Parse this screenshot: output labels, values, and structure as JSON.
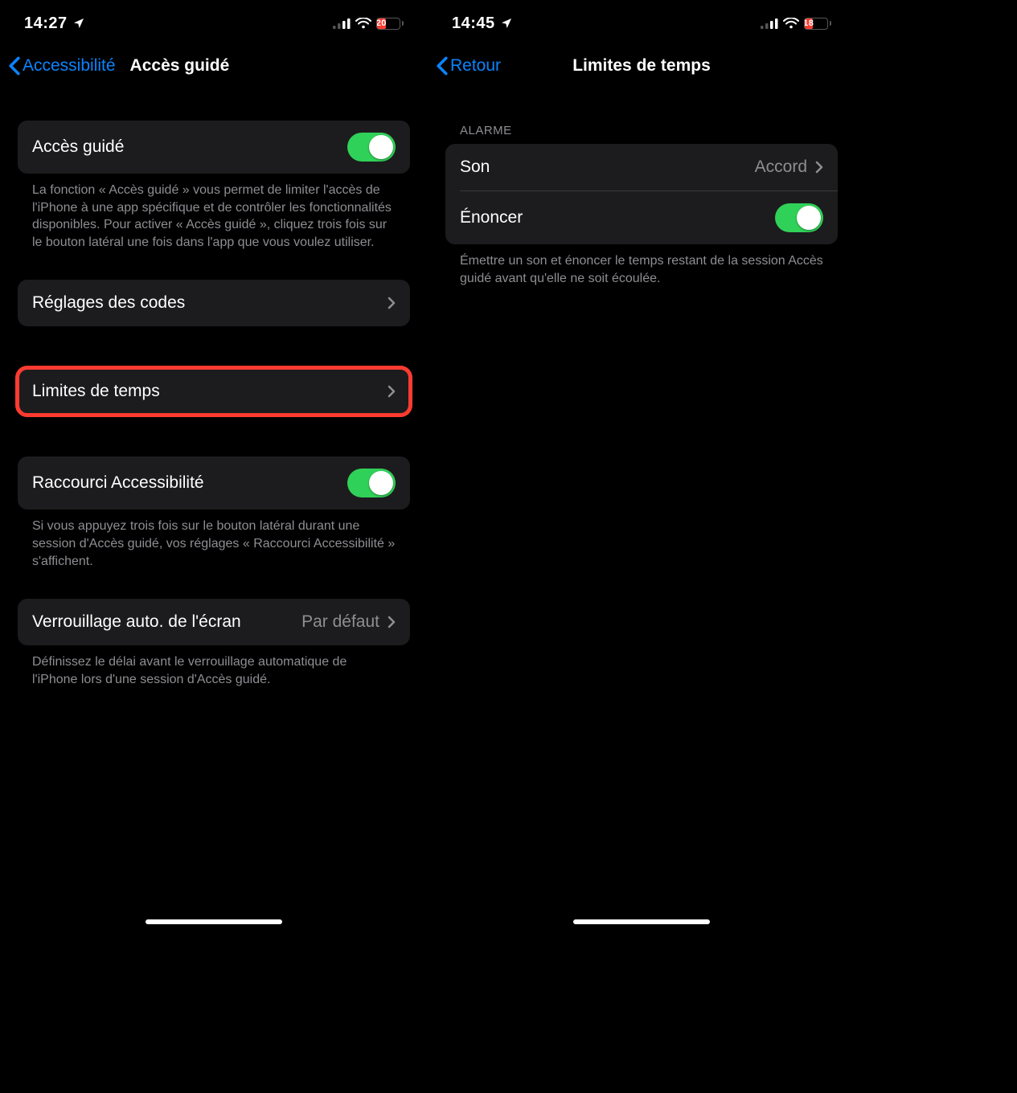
{
  "left": {
    "status": {
      "time": "14:27",
      "battery": "20"
    },
    "nav": {
      "back": "Accessibilité",
      "title": "Accès guidé"
    },
    "toggle1": {
      "label": "Accès guidé"
    },
    "toggle1_footer": "La fonction « Accès guidé » vous permet de limiter l'accès de l'iPhone à une app spécifique et de contrôler les fonctionnalités disponibles. Pour activer « Accès guidé », cliquez trois fois sur le bouton latéral une fois dans l'app que vous voulez utiliser.",
    "codes": {
      "label": "Réglages des codes"
    },
    "limits": {
      "label": "Limites de temps"
    },
    "shortcut": {
      "label": "Raccourci Accessibilité"
    },
    "shortcut_footer": "Si vous appuyez trois fois sur le bouton latéral durant une session d'Accès guidé, vos réglages « Raccourci Accessibilité » s'affichent.",
    "autolock": {
      "label": "Verrouillage auto. de l'écran",
      "value": "Par défaut"
    },
    "autolock_footer": "Définissez le délai avant le verrouillage automatique de l'iPhone lors d'une session d'Accès guidé."
  },
  "right": {
    "status": {
      "time": "14:45",
      "battery": "18"
    },
    "nav": {
      "back": "Retour",
      "title": "Limites de temps"
    },
    "section_header": "ALARME",
    "sound": {
      "label": "Son",
      "value": "Accord"
    },
    "speak": {
      "label": "Énoncer"
    },
    "footer": "Émettre un son et énoncer le temps restant de la session Accès guidé avant qu'elle ne soit écoulée."
  }
}
